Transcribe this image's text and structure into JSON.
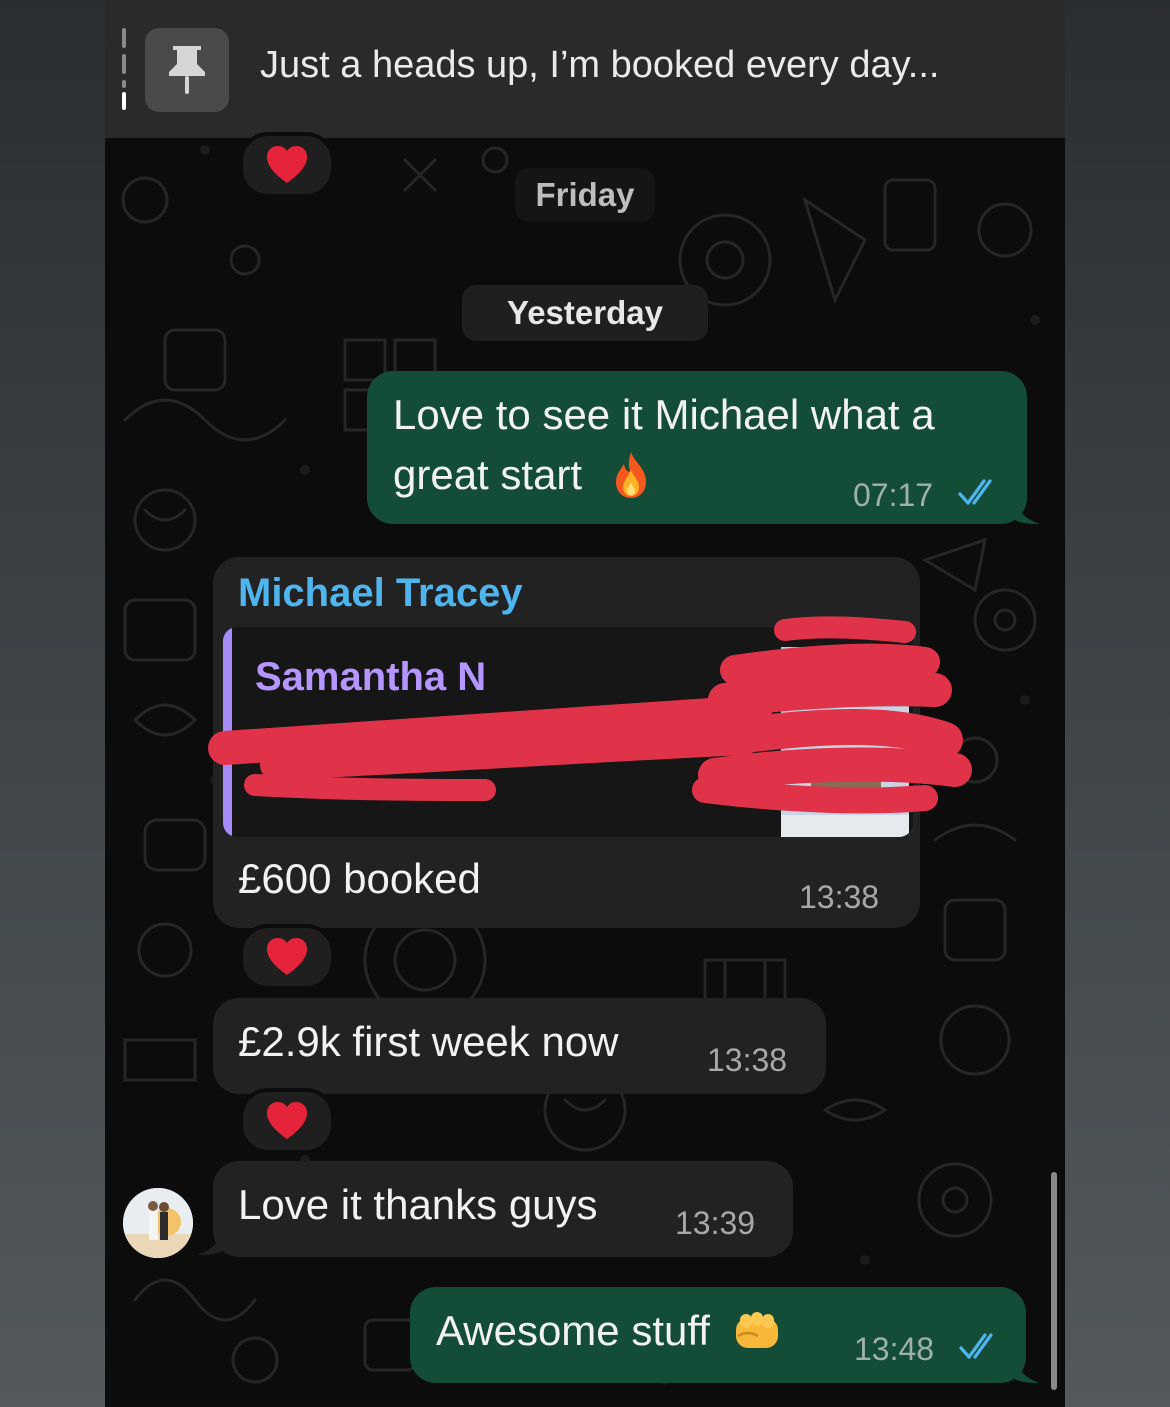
{
  "pinned": {
    "text": "Just a heads up, I’m booked every day...",
    "icon": "pin-icon"
  },
  "dates": {
    "friday": "Friday",
    "yesterday": "Yesterday"
  },
  "messages": [
    {
      "direction": "outgoing",
      "line1": "Love to see it Michael what a",
      "line2": "great start",
      "emoji": "fire",
      "time": "07:17",
      "status": "read"
    },
    {
      "direction": "incoming",
      "sender": "Michael Tracey",
      "quoted_sender": "Samantha N",
      "text": "£600 booked",
      "time": "13:38",
      "reaction": "red-heart"
    },
    {
      "direction": "incoming",
      "text": "£2.9k first week now",
      "time": "13:38",
      "reaction": "red-heart"
    },
    {
      "direction": "incoming",
      "text": "Love it thanks guys",
      "time": "13:39"
    },
    {
      "direction": "outgoing",
      "text": "Awesome stuff",
      "emoji": "oncoming-fist",
      "time": "13:48",
      "status": "read"
    }
  ],
  "colors": {
    "outgoing_bubble": "#144d37",
    "incoming_bubble": "#222222",
    "sender_name": "#4fb5ee",
    "quoted_name": "#b596ff",
    "read_ticks": "#4fb5ee",
    "redaction": "#e0334a"
  }
}
